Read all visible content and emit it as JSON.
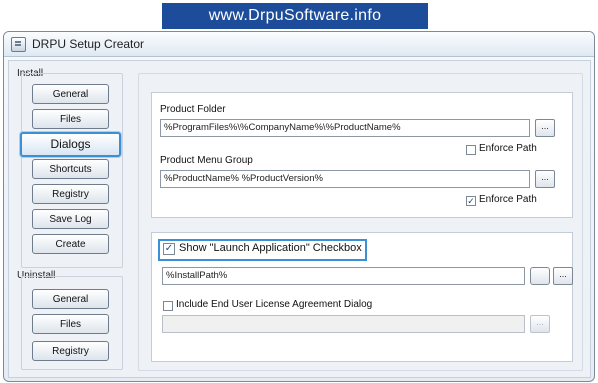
{
  "banner": {
    "text": "www.DrpuSoftware.info"
  },
  "window": {
    "title": "DRPU Setup Creator"
  },
  "install": {
    "label": "Install",
    "buttons": [
      "General",
      "Files",
      "Dialogs",
      "Shortcuts",
      "Registry",
      "Save Log",
      "Create"
    ],
    "active": "Dialogs"
  },
  "uninstall": {
    "label": "Uninstall",
    "buttons": [
      "General",
      "Files",
      "Registry"
    ]
  },
  "product_folder": {
    "label": "Product Folder",
    "value": "%ProgramFiles%\\%CompanyName%\\%ProductName%",
    "browse": "...",
    "enforce_label": "Enforce Path",
    "enforce_checked": false
  },
  "menu_group": {
    "label": "Product Menu Group",
    "value": "%ProductName% %ProductVersion%",
    "browse": "...",
    "enforce_label": "Enforce Path",
    "enforce_checked": true
  },
  "launch": {
    "label": "Show \"Launch Application\" Checkbox",
    "checked": true,
    "value": "%InstallPath%",
    "browse": "..."
  },
  "eula": {
    "label": "Include End User License Agreement Dialog",
    "checked": false,
    "value": "",
    "browse": "..."
  }
}
